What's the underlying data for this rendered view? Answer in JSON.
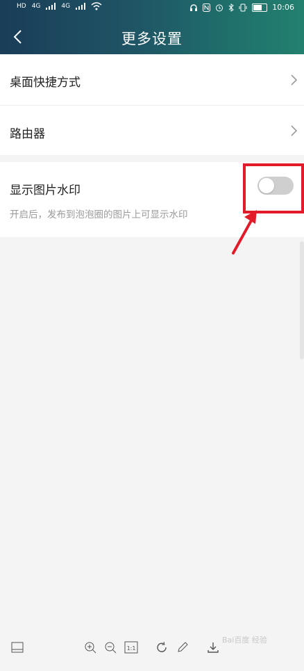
{
  "status_bar": {
    "left_labels": [
      "HD",
      "4G",
      "4G"
    ],
    "time": "10:06"
  },
  "header": {
    "title": "更多设置"
  },
  "settings": {
    "items": [
      {
        "label": "桌面快捷方式"
      },
      {
        "label": "路由器"
      }
    ],
    "watermark": {
      "label": "显示图片水印",
      "description": "开启后，发布到泡泡圈的图片上可显示水印",
      "enabled": false
    }
  },
  "colors": {
    "header_gradient": [
      "#1a3d58",
      "#23806f"
    ],
    "highlight": "#e21b2b",
    "toggle_off": "#cfcfcf"
  },
  "toolbar": {
    "icons": [
      "view-icon",
      "zoom-in-icon",
      "zoom-out-icon",
      "actual-size-icon",
      "rotate-icon",
      "edit-icon",
      "download-icon"
    ],
    "actual_size_label": "1:1"
  },
  "site_watermark": "Bai百度 经验"
}
